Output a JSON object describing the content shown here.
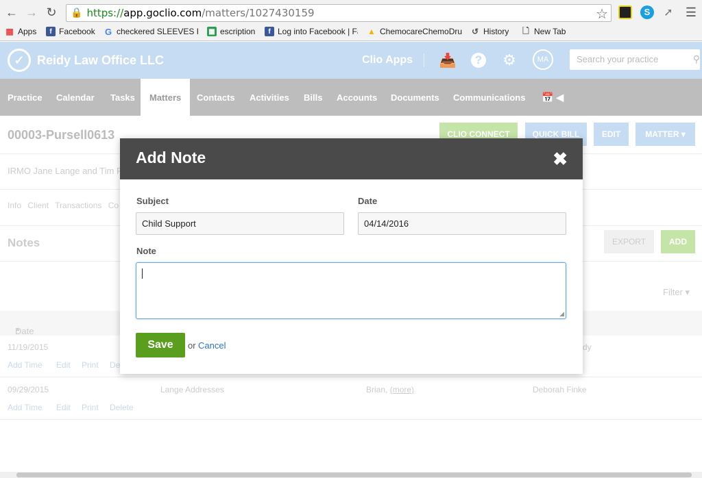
{
  "browser": {
    "url_scheme": "https://",
    "url_host": "app.goclio.com",
    "url_path": "/matters/1027430159",
    "bookmarks": [
      {
        "label": "Apps",
        "icon": "apps-grid-icon"
      },
      {
        "label": "Facebook",
        "icon": "facebook-icon"
      },
      {
        "label": "checkered SLEEVES FA",
        "icon": "google-icon"
      },
      {
        "label": "escription",
        "icon": "sheets-icon"
      },
      {
        "label": "Log into Facebook | Fa",
        "icon": "facebook-icon"
      },
      {
        "label": "ChemocareChemoDru",
        "icon": "drive-icon"
      },
      {
        "label": "History",
        "icon": "history-icon"
      },
      {
        "label": "New Tab",
        "icon": "page-icon"
      }
    ]
  },
  "header": {
    "firm_name": "Reidy Law Office LLC",
    "clio_apps": "Clio Apps",
    "avatar_initials": "MA",
    "search_placeholder": "Search your practice"
  },
  "nav": {
    "items": [
      "Practice",
      "Calendar",
      "Tasks",
      "Matters",
      "Contacts",
      "Activities",
      "Bills",
      "Accounts",
      "Documents",
      "Communications"
    ],
    "active": "Matters"
  },
  "matter": {
    "title": "00003-Pursell0613",
    "buttons": [
      "CLIO CONNECT",
      "QUICK BILL",
      "EDIT",
      "MATTER ▾"
    ],
    "description": "IRMO Jane Lange and Tim P",
    "tabs": [
      "Info",
      "Client",
      "Transactions",
      "Co"
    ]
  },
  "notes": {
    "title": "Notes",
    "export_label": "EXPORT",
    "add_label": "ADD",
    "filter_label": "Filter",
    "date_header": "Date",
    "rows": [
      {
        "date": "11/19/2015",
        "subject": "",
        "note": "",
        "author": "dy"
      },
      {
        "date": "09/29/2015",
        "subject": "Lange Addresses",
        "note": "Brian,",
        "more": "(more)",
        "author": "Deborah Finke"
      }
    ],
    "row_actions": [
      "Add Time",
      "Edit",
      "Print",
      "Delete"
    ],
    "row_actions_partial": [
      "Add Time",
      "Edit",
      "Print",
      "De"
    ]
  },
  "modal": {
    "title": "Add Note",
    "subject_label": "Subject",
    "subject_value": "Child Support",
    "date_label": "Date",
    "date_value": "04/14/2016",
    "note_label": "Note",
    "note_value": "",
    "save_label": "Save",
    "or_text": "or",
    "cancel_label": "Cancel"
  }
}
